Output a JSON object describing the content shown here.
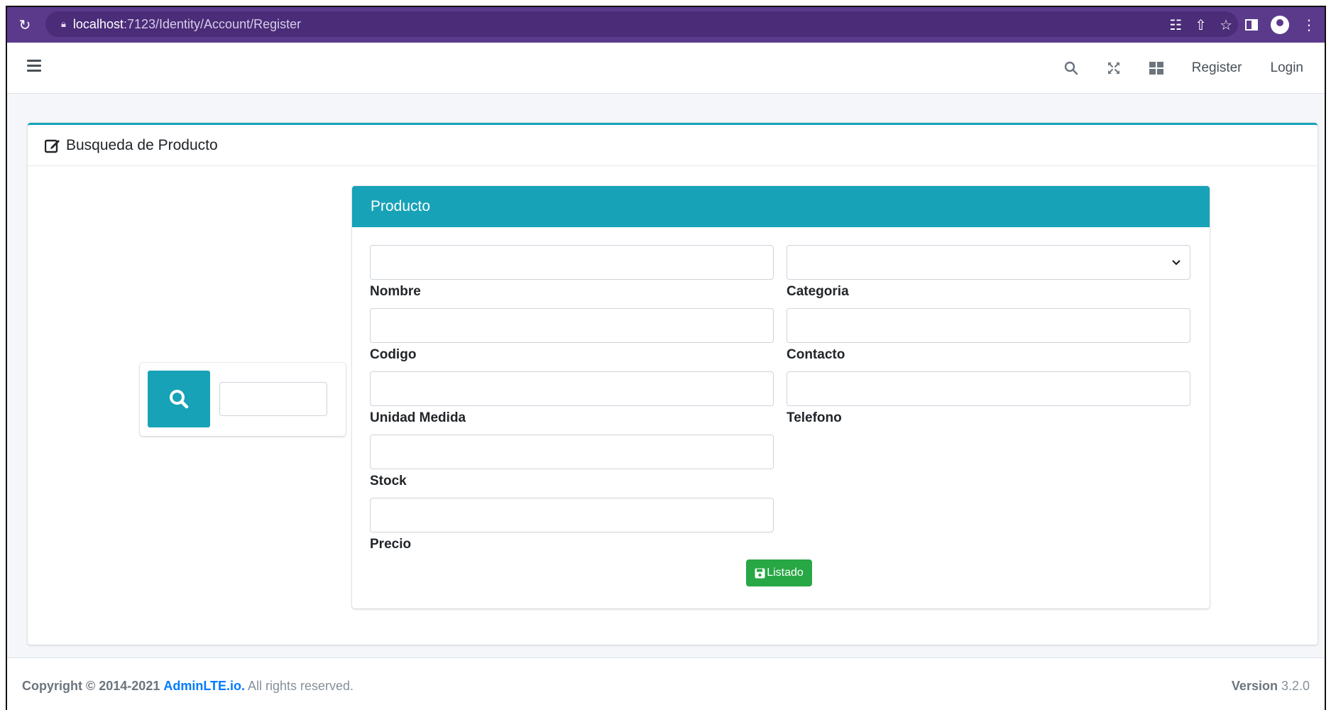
{
  "browser": {
    "url_host": "localhost",
    "url_path": ":7123/Identity/Account/Register"
  },
  "navbar": {
    "register_label": "Register",
    "login_label": "Login"
  },
  "card": {
    "title": "Busqueda de Producto"
  },
  "panel": {
    "title": "Producto",
    "fields": {
      "nombre": "Nombre",
      "categoria": "Categoria",
      "codigo": "Codigo",
      "contacto": "Contacto",
      "unidad_medida": "Unidad Medida",
      "telefono": "Telefono",
      "stock": "Stock",
      "precio": "Precio"
    },
    "button_label": "Listado"
  },
  "footer": {
    "copyright_prefix": "Copyright © 2014-2021 ",
    "brand": "AdminLTE.io.",
    "rights": " All rights reserved.",
    "version_label": "Version",
    "version_number": " 3.2.0"
  },
  "colors": {
    "browser_bar": "#5b3a8c",
    "accent": "#17a2b8",
    "success": "#28a745",
    "link": "#007bff"
  }
}
